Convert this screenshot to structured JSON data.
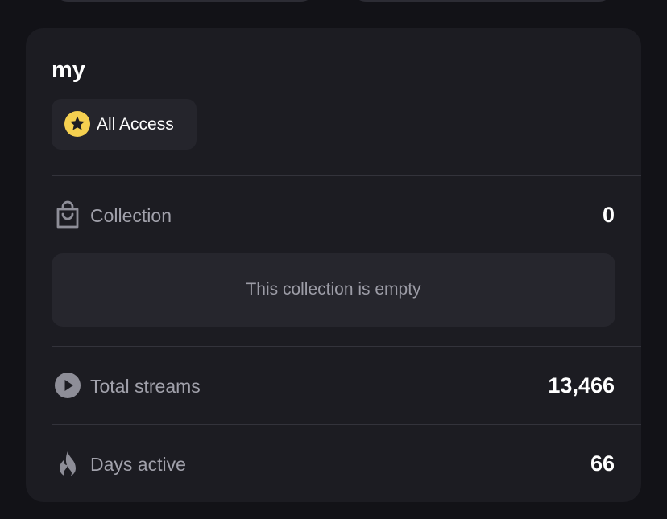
{
  "profile": {
    "username": "my",
    "badge": {
      "label": "All Access",
      "icon": "star-icon",
      "color": "#f5d050"
    }
  },
  "stats": {
    "collection": {
      "icon": "shopping-bag-icon",
      "label": "Collection",
      "value": "0",
      "empty_message": "This collection is empty"
    },
    "total_streams": {
      "icon": "play-circle-icon",
      "label": "Total streams",
      "value": "13,466"
    },
    "days_active": {
      "icon": "flame-icon",
      "label": "Days active",
      "value": "66"
    }
  },
  "colors": {
    "background": "#121217",
    "card": "#1c1c22",
    "badge_background": "#25252c",
    "muted_text": "#a1a1ab",
    "value_text": "#ffffff"
  }
}
